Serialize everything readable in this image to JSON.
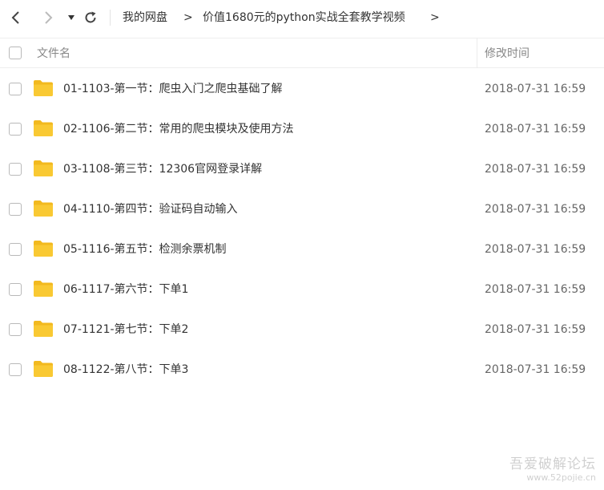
{
  "nav": {
    "breadcrumb_root": "我的网盘",
    "separator": ">",
    "breadcrumb_current": "价值1680元的python实战全套教学视频"
  },
  "header": {
    "name_label": "文件名",
    "time_label": "修改时间"
  },
  "files": [
    {
      "name": "01-1103-第一节：爬虫入门之爬虫基础了解",
      "time": "2018-07-31 16:59",
      "icon": "folder-icon"
    },
    {
      "name": "02-1106-第二节：常用的爬虫模块及使用方法",
      "time": "2018-07-31 16:59",
      "icon": "folder-icon"
    },
    {
      "name": "03-1108-第三节：12306官网登录详解",
      "time": "2018-07-31 16:59",
      "icon": "folder-icon"
    },
    {
      "name": "04-1110-第四节：验证码自动输入",
      "time": "2018-07-31 16:59",
      "icon": "folder-icon"
    },
    {
      "name": "05-1116-第五节：检测余票机制",
      "time": "2018-07-31 16:59",
      "icon": "folder-icon"
    },
    {
      "name": "06-1117-第六节：下单1",
      "time": "2018-07-31 16:59",
      "icon": "folder-icon"
    },
    {
      "name": "07-1121-第七节：下单2",
      "time": "2018-07-31 16:59",
      "icon": "folder-icon"
    },
    {
      "name": "08-1122-第八节：下单3",
      "time": "2018-07-31 16:59",
      "icon": "folder-icon"
    }
  ],
  "watermark": {
    "line1": "吾爱破解论坛",
    "line2": "www.52pojie.cn"
  },
  "colors": {
    "folder": "#f9c933",
    "folder_tab": "#f2b91f"
  }
}
